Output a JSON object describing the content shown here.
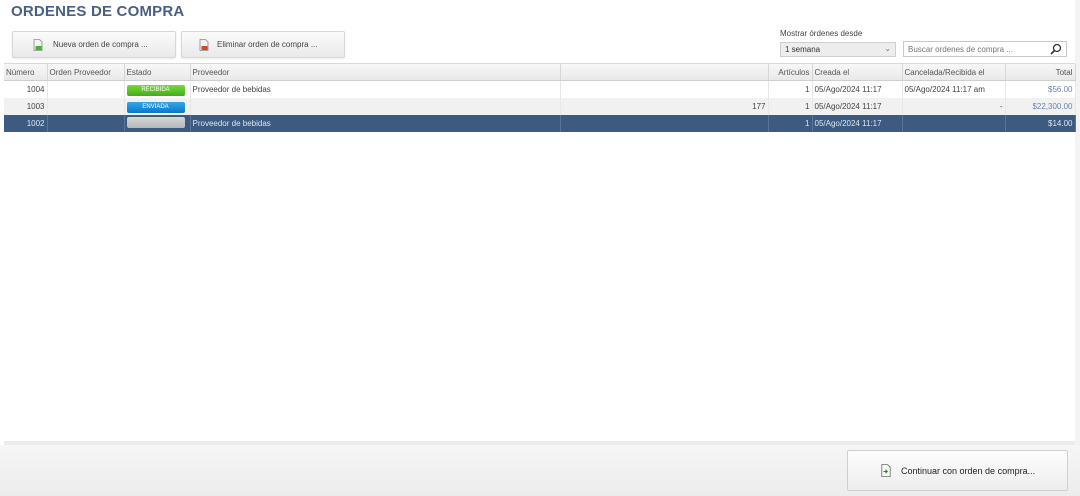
{
  "page_title": "ORDENES DE COMPRA",
  "toolbar": {
    "new_order_label": "Nueva orden de compra ...",
    "delete_order_label": "Eliminar orden de compra ..."
  },
  "filter": {
    "label": "Mostrar órdenes desde",
    "selected": "1 semana",
    "search_placeholder": "Buscar ordenes de compra ..."
  },
  "table": {
    "columns": [
      "Número",
      "Orden Proveedor",
      "Estado",
      "Proveedor",
      "",
      "Artículos",
      "Creada el",
      "Cancelada/Recibida el",
      "Total"
    ],
    "rows": [
      {
        "numero": "1004",
        "orden_proveedor": "",
        "estado": "RECIBIDA",
        "estado_color": "#4cba1e",
        "proveedor": "Proveedor de bebidas",
        "extra": "",
        "articulos": "1",
        "creada": "05/Ago/2024 11:17",
        "cancelada": "05/Ago/2024 11:17 am",
        "total": "$56.00"
      },
      {
        "numero": "1003",
        "orden_proveedor": "",
        "estado": "ENVIADA",
        "estado_color": "#0f82d2",
        "proveedor": "",
        "extra": "177",
        "articulos": "1",
        "creada": "05/Ago/2024 11:17",
        "cancelada": "-",
        "total": "$22,300.00"
      },
      {
        "numero": "1002",
        "orden_proveedor": "",
        "estado": "",
        "estado_color": "#c4c4c4",
        "proveedor": "Proveedor de bebidas",
        "extra": "",
        "articulos": "1",
        "creada": "05/Ago/2024 11:17",
        "cancelada": "",
        "total": "$14.00"
      }
    ]
  },
  "footer": {
    "continue_label": "Continuar con orden de compra..."
  },
  "colors": {
    "title": "#4a5f86",
    "selected_row": "#3d5a80",
    "money": "#6b84b5"
  }
}
